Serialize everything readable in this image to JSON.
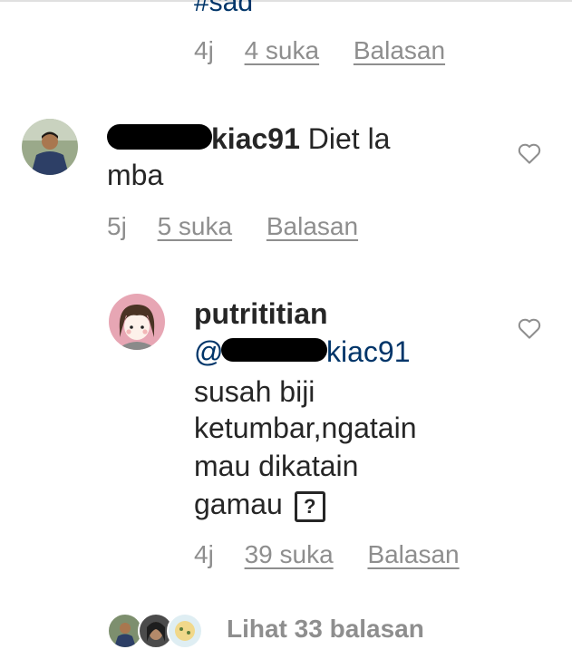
{
  "top": {
    "hashtag": "#sad",
    "time": "4j",
    "likes": "4 suka",
    "reply": "Balasan"
  },
  "comment1": {
    "username": "kiac91",
    "text_line1": "Diet la",
    "text_line2": "mba",
    "time": "5j",
    "likes": "5 suka",
    "reply": "Balasan"
  },
  "reply1": {
    "username": "putrititian",
    "mention": "@",
    "mention_suffix": "kiac91",
    "lines": [
      "susah biji",
      "ketumbar,ngatain",
      "mau dikatain",
      "gamau"
    ],
    "emoji": "?",
    "time": "4j",
    "likes": "39 suka",
    "reply": "Balasan"
  },
  "view_replies": "Lihat 33 balasan",
  "icons": {
    "like": "heart-outline-icon",
    "emoji": "question-mark-box-icon"
  },
  "colors": {
    "text": "#262626",
    "meta": "#8e8e8e",
    "mention": "#003569"
  }
}
